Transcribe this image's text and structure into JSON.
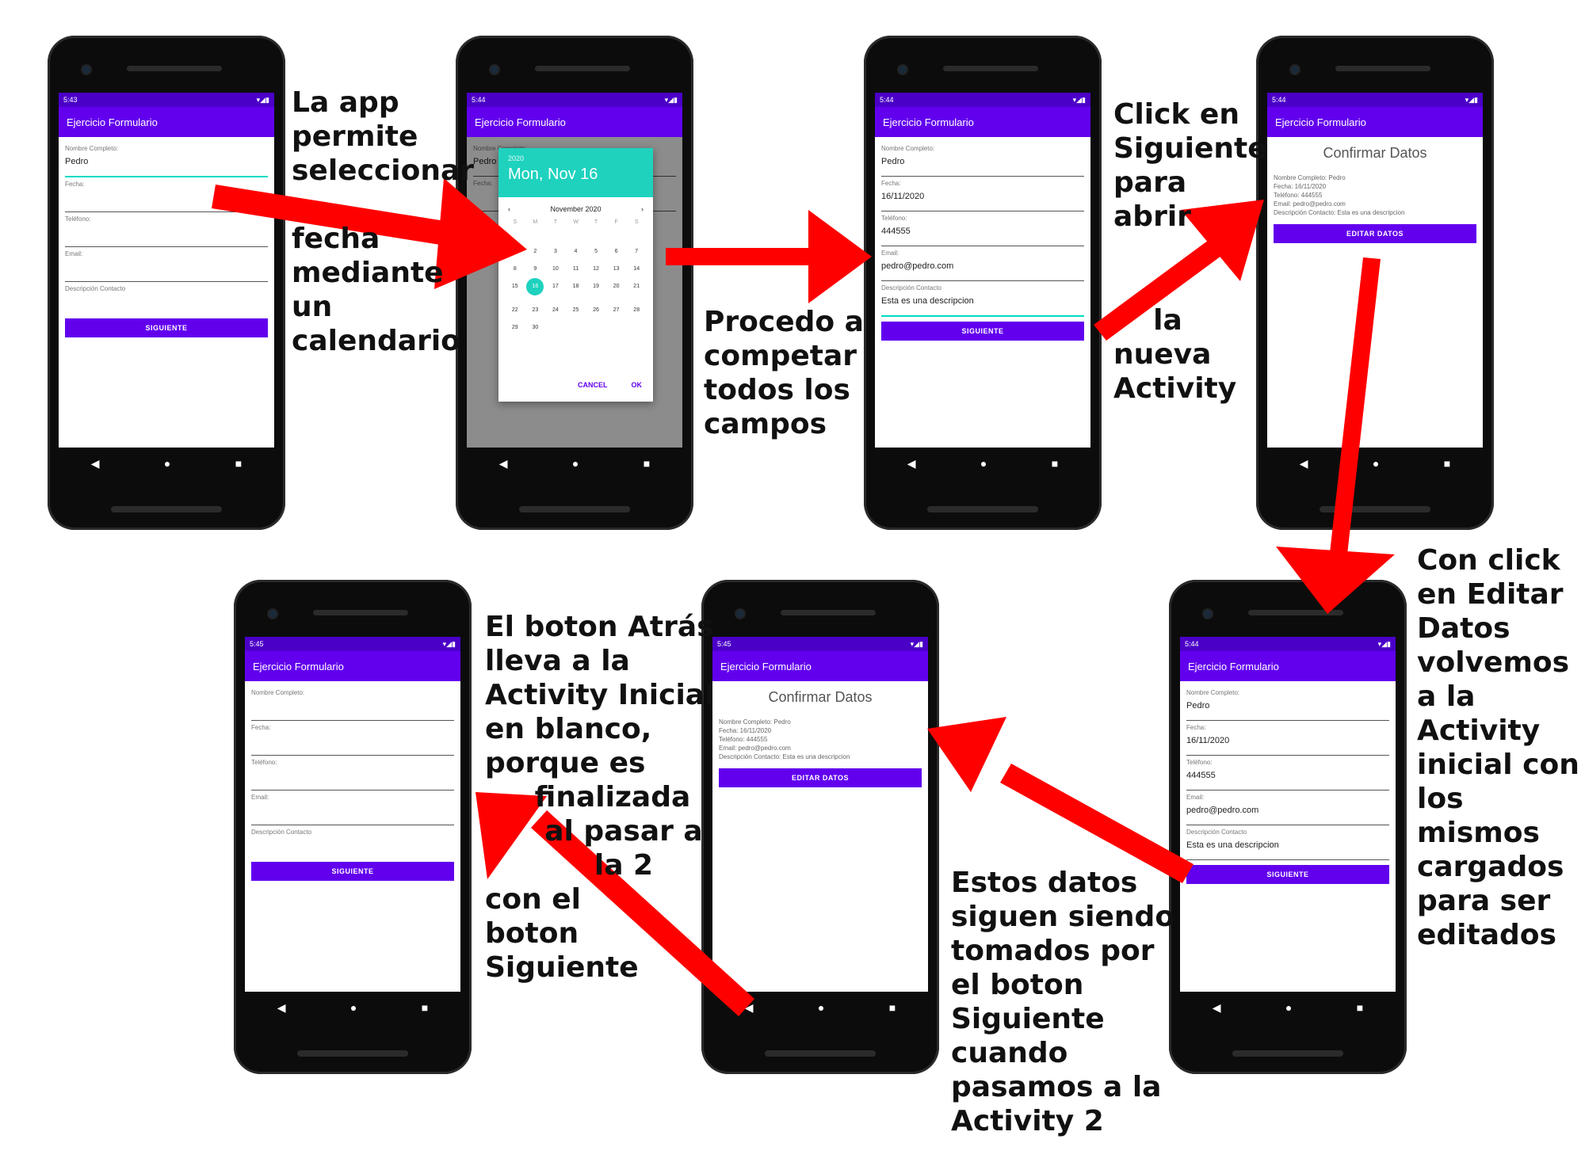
{
  "app": {
    "title": "Ejercicio Formulario",
    "labels": {
      "name": "Nombre Completo:",
      "date": "Fecha:",
      "phone": "Teléfono:",
      "email": "Email:",
      "desc": "Descripción Contacto"
    },
    "button_next": "SIGUIENTE",
    "button_edit": "EDITAR DATOS",
    "confirm_title": "Confirmar Datos",
    "confirm_lines": [
      "Nombre Completo:  Pedro",
      "Fecha:  16/11/2020",
      "Teléfono:  444555",
      "Email:  pedro@pedro.com",
      "Descripción Contacto:  Esta es una descripcion"
    ],
    "values": {
      "name": "Pedro",
      "date": "16/11/2020",
      "phone": "444555",
      "email": "pedro@pedro.com",
      "desc": "Esta es una descripcion"
    },
    "status_times": [
      "5:43",
      "5:44",
      "5:44",
      "5:44",
      "5:44",
      "5:45",
      "5:45"
    ]
  },
  "calendar": {
    "year": "2020",
    "selected_label": "Mon, Nov 16",
    "month_label": "November 2020",
    "dow": [
      "S",
      "M",
      "T",
      "W",
      "T",
      "F",
      "S"
    ],
    "days": [
      "",
      "",
      "",
      "",
      "",
      "",
      "",
      "1",
      "2",
      "3",
      "4",
      "5",
      "6",
      "7",
      "8",
      "9",
      "10",
      "11",
      "12",
      "13",
      "14",
      "15",
      "16",
      "17",
      "18",
      "19",
      "20",
      "21",
      "22",
      "23",
      "24",
      "25",
      "26",
      "27",
      "28",
      "29",
      "30"
    ],
    "selected_day": "16",
    "cancel": "CANCEL",
    "ok": "OK"
  },
  "captions": {
    "c1": "La app\npermite\nseleccionar\n\nfecha\nmediante\nun\ncalendario",
    "c2": "Procedo a\ncompetar\ntodos los\ncampos",
    "c3": "Click en\nSiguiente\npara\nabrir",
    "c3b": "    la\nnueva\nActivity",
    "c4": "Con click\nen Editar\nDatos\nvolvemos\na la\nActivity\ninicial con\nlos\nmismos\ncargados\npara ser\neditados",
    "c5": "Estos datos\nsiguen siendo\ntomados por\nel boton\nSiguiente\ncuando\npasamos a la\nActivity 2",
    "c6": "El boton Atrás\nlleva a la\nActivity Inicial\nen blanco,\nporque es\n     finalizada\n      al pasar a\n           la 2\ncon el\nboton\nSiguiente"
  },
  "colors": {
    "primary": "#6200ee",
    "status": "#4b00c8",
    "accent": "#1ed2be",
    "arrow": "#ff0000"
  }
}
